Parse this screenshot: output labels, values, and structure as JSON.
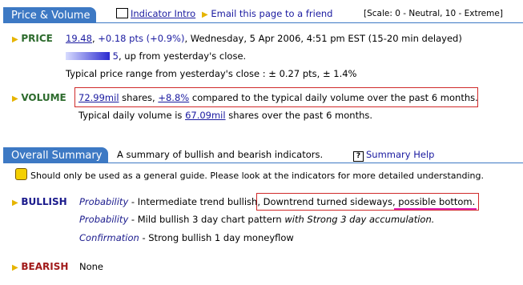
{
  "price_volume": {
    "tab": "Price & Volume",
    "indicator_intro": "Indicator Intro",
    "email_link": "Email this page to a friend",
    "scale": "[Scale: 0 - Neutral, 10 - Extreme]"
  },
  "price": {
    "label": "PRICE",
    "value": "19.48",
    "change": "+0.18 pts (+0.9%)",
    "date_text": ", Wednesday, 5 Apr 2006, 4:51 pm EST (15-20 min delayed)",
    "bar_score": "5",
    "bar_text": ", up from yesterday's close.",
    "range_text": "Typical price range from yesterday's close : ± 0.27 pts, ± 1.4%"
  },
  "volume": {
    "label": "VOLUME",
    "shares": "72.99mil",
    "shares_text": " shares, ",
    "pct": "+8.8%",
    "compare_text": " compared to the typical daily volume over the past 6 months.",
    "typical_prefix": "Typical daily volume is ",
    "typical_value": "67.09mil",
    "typical_suffix": " shares over the past 6 months."
  },
  "overall": {
    "tab": "Overall Summary",
    "desc": "A summary of bullish and bearish indicators.",
    "help": "Summary Help",
    "guide": "Should only be used as a general guide. Please look at the indicators for more detailed understanding."
  },
  "bullish": {
    "label": "BULLISH",
    "r1_key": "Probability",
    "r1_text": " - Intermediate trend bullish, ",
    "r1_box": "Downtrend turned sideways, possible bottom.",
    "r2_key": "Probability",
    "r2_text": " - Mild bullish 3 day chart pattern ",
    "r2_ital": "with Strong 3 day accumulation.",
    "r3_key": "Confirmation",
    "r3_text": " - Strong bullish 1 day moneyflow"
  },
  "bearish": {
    "label": "BEARISH",
    "value": "None"
  },
  "colors": {
    "accent": "#3d79c4",
    "highlight_box": "#d02a2a",
    "underline": "#e020b0"
  },
  "price_bar_score": 5
}
